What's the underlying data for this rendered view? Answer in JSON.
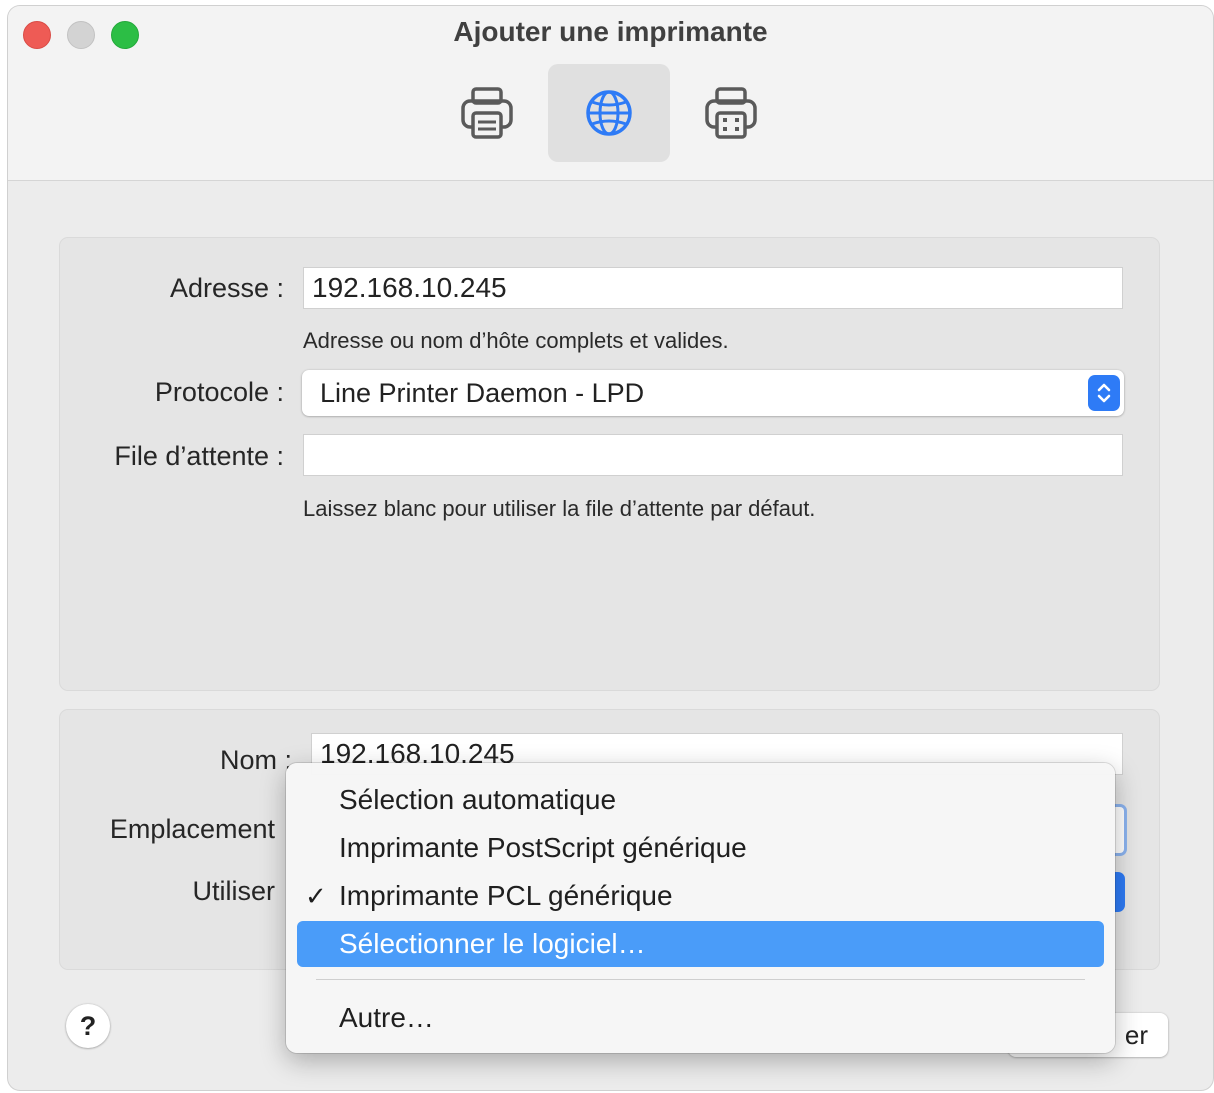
{
  "window": {
    "title": "Ajouter une imprimante"
  },
  "toolbar": {
    "buttons": [
      {
        "name": "default-printer",
        "icon": "printer-icon",
        "selected": false
      },
      {
        "name": "ip-printer",
        "icon": "globe-icon",
        "selected": true
      },
      {
        "name": "windows-printer",
        "icon": "fax-printer-icon",
        "selected": false
      }
    ]
  },
  "form": {
    "address": {
      "label": "Adresse :",
      "value": "192.168.10.245",
      "hint": "Adresse ou nom d’hôte complets et valides."
    },
    "protocol": {
      "label": "Protocole :",
      "value": "Line Printer Daemon - LPD"
    },
    "queue": {
      "label": "File d’attente :",
      "value": "",
      "hint": "Laissez blanc pour utiliser la file d’attente par défaut."
    }
  },
  "details": {
    "name": {
      "label": "Nom :",
      "value": "192.168.10.245"
    },
    "location": {
      "label": "Emplacement"
    },
    "use": {
      "label": "Utiliser"
    }
  },
  "footer": {
    "help_label": "?",
    "add_button_visible_text": "er"
  },
  "menu": {
    "items": [
      {
        "label": "Sélection automatique",
        "checked": false,
        "highlighted": false
      },
      {
        "label": "Imprimante PostScript générique",
        "checked": false,
        "highlighted": false
      },
      {
        "label": "Imprimante PCL générique",
        "checked": true,
        "highlighted": false
      },
      {
        "label": "Sélectionner le logiciel…",
        "checked": false,
        "highlighted": true
      },
      {
        "label": "Autre…",
        "checked": false,
        "highlighted": false
      }
    ],
    "check_glyph": "✓"
  },
  "colors": {
    "accent": "#2e7bf6",
    "highlight": "#4a9cf9",
    "close": "#ee5b55",
    "zoom": "#2cbe45"
  }
}
